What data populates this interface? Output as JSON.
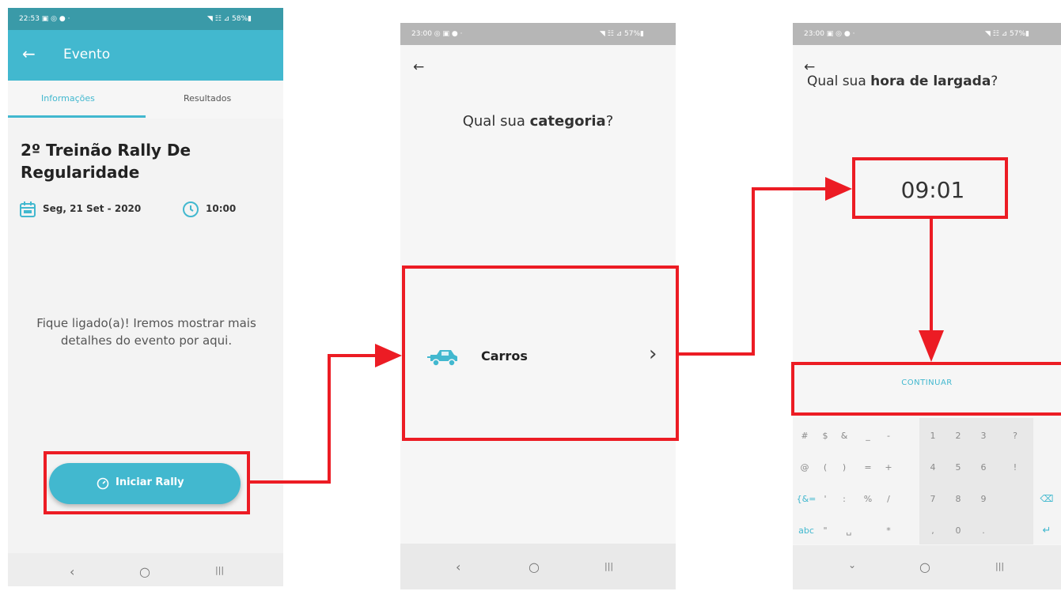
{
  "screen1": {
    "status_time": "22:53 ▣ ◎ ● ·",
    "status_right": "◥ ☷ ⊿ 58%▮",
    "app_title": "Evento",
    "tabs": [
      "Informações",
      "Resultados"
    ],
    "event_title": "2º Treinão Rally De Regularidade",
    "event_date": "Seg, 21 Set - 2020",
    "event_time": "10:00",
    "info_message": "Fique ligado(a)! Iremos mostrar mais detalhes do evento por aqui.",
    "start_button": "Iniciar Rally"
  },
  "screen2": {
    "status_time": "23:00 ◎ ▣ ● ·",
    "status_right": "◥ ☷ ⊿ 57%▮",
    "question_prefix": "Qual sua ",
    "question_bold": "categoria",
    "question_suffix": "?",
    "category": "Carros"
  },
  "screen3": {
    "status_time": "23:00 ▣ ◎ ● ·",
    "status_right": "◥ ☷ ⊿ 57%▮",
    "question_prefix": "Qual sua ",
    "question_bold": "hora de largada",
    "question_suffix": "?",
    "time_value": "09:01",
    "continue_button": "CONTINUAR",
    "keyboard_rows": [
      [
        "#",
        "$",
        "&",
        "_",
        "-",
        "1",
        "2",
        "3",
        "?"
      ],
      [
        "@",
        "(",
        ")",
        "=",
        "+",
        "4",
        "5",
        "6",
        "!"
      ],
      [
        "{&=",
        "'",
        ":",
        "%",
        "/",
        "7",
        "8",
        "9",
        "⌫"
      ],
      [
        "abc",
        "\"",
        "␣",
        "*",
        ",",
        "0",
        ".",
        "↵"
      ]
    ]
  },
  "nav": {
    "back": "‹",
    "home": "○",
    "recents": "|||"
  },
  "icons": {
    "back_arrow": "←",
    "chevron": "›"
  },
  "colors": {
    "teal": "#42b8cf",
    "teal_dark": "#34a1b6",
    "highlight": "#ec1c24",
    "key_gray": "#e8e8e8"
  }
}
